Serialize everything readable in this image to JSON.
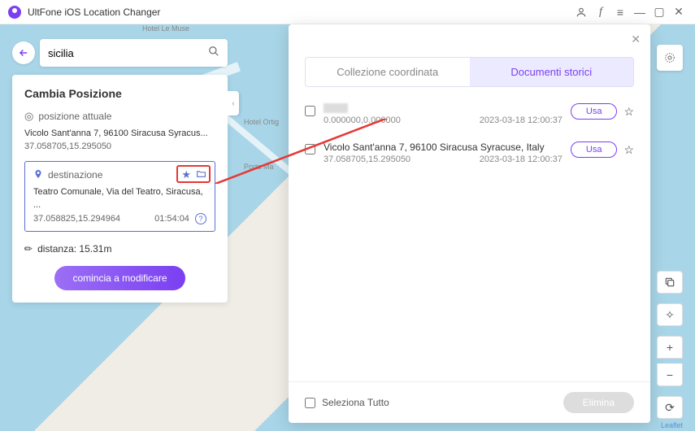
{
  "titlebar": {
    "title": "UltFone iOS Location Changer"
  },
  "search": {
    "value": "sicilia"
  },
  "panel": {
    "heading": "Cambia Posizione",
    "current": {
      "label": "posizione attuale",
      "address": "Vicolo Sant'anna 7, 96100 Siracusa Syracus...",
      "coords": "37.058705,15.295050"
    },
    "destination": {
      "label": "destinazione",
      "address": "Teatro Comunale, Via del Teatro, Siracusa, ...",
      "coords": "37.058825,15.294964",
      "time": "01:54:04"
    },
    "distance_label": "distanza: 15.31m",
    "start_button": "comincia a modificare"
  },
  "map_labels": {
    "l1": "Hotel Le Muse",
    "l2": "Hotel Ortig",
    "l3": "Porta Ma"
  },
  "popup": {
    "tabs": {
      "collection": "Collezione coordinata",
      "history": "Documenti storici"
    },
    "items": [
      {
        "blurred": true,
        "coords": "0.000000,0.000000",
        "timestamp": "2023-03-18 12:00:37",
        "use": "Usa"
      },
      {
        "address": "Vicolo Sant'anna 7, 96100 Siracusa Syracuse, Italy",
        "coords": "37.058705,15.295050",
        "timestamp": "2023-03-18 12:00:37",
        "use": "Usa"
      }
    ],
    "select_all": "Seleziona Tutto",
    "delete": "Elimina"
  },
  "attribution": "Leaflet"
}
